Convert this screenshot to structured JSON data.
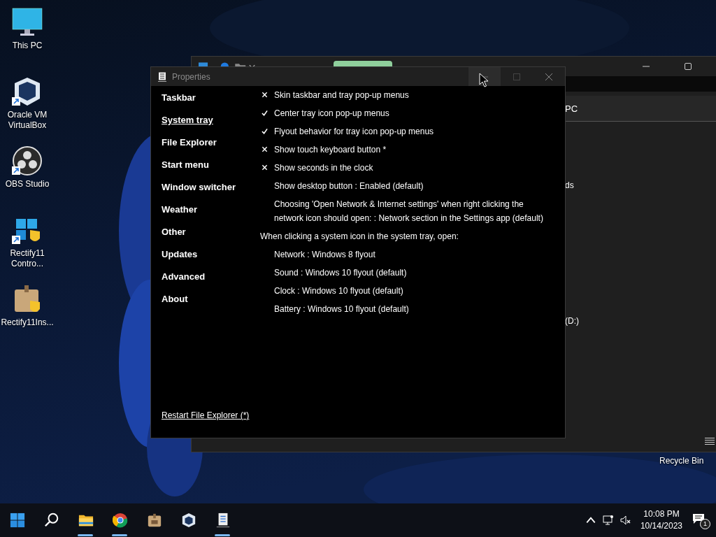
{
  "desktop_icons": [
    {
      "kind": "monitor",
      "label": "This PC",
      "shortcut": false
    },
    {
      "kind": "cube",
      "label": "Oracle VM VirtualBox",
      "shortcut": true
    },
    {
      "kind": "obs",
      "label": "OBS Studio",
      "shortcut": true
    },
    {
      "kind": "windows",
      "label": "Rectify11 Contro...",
      "shortcut": true
    },
    {
      "kind": "package",
      "label": "Rectify11Ins...",
      "shortcut": false
    }
  ],
  "recycle_bin": {
    "label": "Recycle Bin"
  },
  "explorer_window": {
    "fragments": [
      "PC",
      "ds",
      "(D:)"
    ]
  },
  "properties_window": {
    "title": "Properties",
    "sidebar": [
      {
        "label": "Taskbar",
        "selected": false
      },
      {
        "label": "System tray",
        "selected": true
      },
      {
        "label": "File Explorer",
        "selected": false
      },
      {
        "label": "Start menu",
        "selected": false
      },
      {
        "label": "Window switcher",
        "selected": false
      },
      {
        "label": "Weather",
        "selected": false
      },
      {
        "label": "Other",
        "selected": false
      },
      {
        "label": "Updates",
        "selected": false
      },
      {
        "label": "Advanced",
        "selected": false
      },
      {
        "label": "About",
        "selected": false
      }
    ],
    "options": [
      {
        "kind": "check",
        "label": "Skin taskbar and tray pop-up menus",
        "checked": false
      },
      {
        "kind": "check",
        "label": "Center tray icon pop-up menus",
        "checked": true
      },
      {
        "kind": "check",
        "label": "Flyout behavior for tray icon pop-up menus",
        "checked": true
      },
      {
        "kind": "check",
        "label": "Show touch keyboard button *",
        "checked": false
      },
      {
        "kind": "check",
        "label": "Show seconds in the clock",
        "checked": false
      },
      {
        "kind": "setting",
        "label": "Show desktop button : Enabled (default)"
      },
      {
        "kind": "setting",
        "label": "Choosing 'Open Network & Internet settings' when right clicking the network icon should open: : Network section in the Settings app (default)"
      },
      {
        "kind": "heading",
        "label": "When clicking a system icon in the system tray, open:"
      },
      {
        "kind": "setting",
        "label": "Network : Windows 8 flyout"
      },
      {
        "kind": "setting",
        "label": "Sound : Windows 10 flyout (default)"
      },
      {
        "kind": "setting",
        "label": "Clock : Windows 10 flyout (default)"
      },
      {
        "kind": "setting",
        "label": "Battery : Windows 10 flyout (default)"
      }
    ],
    "footer_link": "Restart File Explorer (*)"
  },
  "taskbar": {
    "apps": [
      {
        "kind": "start",
        "open": false
      },
      {
        "kind": "search",
        "open": false
      },
      {
        "kind": "folder",
        "open": true
      },
      {
        "kind": "browser",
        "open": true
      },
      {
        "kind": "package",
        "open": false
      },
      {
        "kind": "cube",
        "open": false
      },
      {
        "kind": "app",
        "open": true
      }
    ],
    "clock": {
      "time": "10:08 PM",
      "date": "10/14/2023"
    },
    "notifications": "1"
  }
}
